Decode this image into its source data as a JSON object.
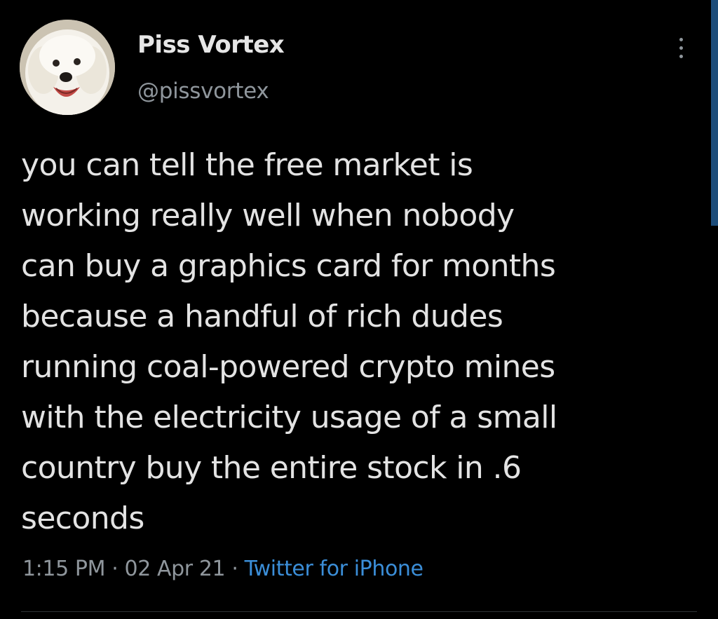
{
  "author": {
    "display_name": "Piss Vortex",
    "handle": "@pissvortex",
    "avatar_icon": "white-dog-avatar"
  },
  "tweet": {
    "lines": [
      "you can tell the free market is",
      "working really well when nobody",
      "can buy a graphics card for months",
      "because a handful of rich dudes",
      "running coal-powered crypto mines",
      "with the electricity usage of a small",
      "country buy the entire stock in .6",
      "seconds"
    ],
    "time": "1:15 PM",
    "date": "02 Apr 21",
    "separator": "·",
    "source": "Twitter for iPhone"
  },
  "icons": {
    "more": "more-vertical-icon"
  },
  "colors": {
    "background": "#000000",
    "text": "#e3e3e3",
    "secondary_text": "#8f969c",
    "link": "#3b8ed8",
    "scrollbar": "#1d4d7a"
  }
}
